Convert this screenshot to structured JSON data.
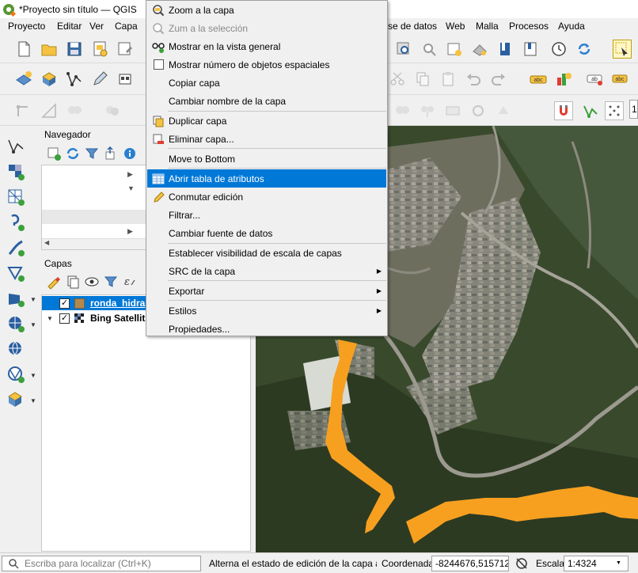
{
  "window": {
    "title": "*Proyecto sin título — QGIS"
  },
  "menubar": {
    "items": [
      "Proyecto",
      "Editar",
      "Ver",
      "Capa",
      "se de datos",
      "Web",
      "Malla",
      "Procesos",
      "Ayuda"
    ]
  },
  "browser_panel": {
    "title": "Navegador"
  },
  "layers_panel": {
    "title": "Capas",
    "layers": [
      {
        "name": "ronda_hidra",
        "checked": true,
        "color": "#b08850"
      },
      {
        "name": "Bing Satellit",
        "checked": true
      }
    ]
  },
  "context_menu": {
    "items": [
      {
        "label": "Zoom a la capa",
        "icon": "zoom-layer-icon",
        "disabled": false
      },
      {
        "label": "Zum a la selección",
        "icon": "zoom-selection-icon",
        "disabled": true
      },
      {
        "label": "Mostrar en la vista general",
        "icon": "overview-icon",
        "disabled": false
      },
      {
        "label": "Mostrar número de objetos espaciales",
        "icon": "checkbox",
        "disabled": false
      },
      {
        "label": "Copiar capa",
        "disabled": false
      },
      {
        "label": "Cambiar nombre de la capa",
        "disabled": false
      },
      {
        "label": "Duplicar capa",
        "icon": "duplicate-icon",
        "disabled": false
      },
      {
        "label": "Eliminar capa...",
        "icon": "remove-layer-icon",
        "disabled": false
      },
      {
        "label": "Move to Bottom",
        "disabled": false
      },
      {
        "label": "Abrir tabla de atributos",
        "icon": "attribute-table-icon",
        "highlighted": true
      },
      {
        "label": "Conmutar edición",
        "icon": "pencil-icon",
        "disabled": false
      },
      {
        "label": "Filtrar...",
        "disabled": false
      },
      {
        "label": "Cambiar fuente de datos",
        "disabled": false
      },
      {
        "label": "Establecer visibilidad de escala de capas",
        "disabled": false
      },
      {
        "label": "SRC de la capa",
        "submenu": true
      },
      {
        "label": "Exportar",
        "submenu": true
      },
      {
        "label": "Estilos",
        "submenu": true
      },
      {
        "label": "Propiedades...",
        "disabled": false
      }
    ]
  },
  "statusbar": {
    "locator_placeholder": "Escriba para localizar (Ctrl+K)",
    "message": "Alterna el estado de edición de la capa activ",
    "coord_label": "Coordenada",
    "coord_value": "-8244676,515712",
    "scale_label": "Escala",
    "scale_value": "1:4324"
  },
  "right_edge": {
    "value": "1"
  },
  "colors": {
    "highlight": "#0078d7",
    "layer_fill": "#f7a020",
    "qgis_green": "#589632"
  }
}
